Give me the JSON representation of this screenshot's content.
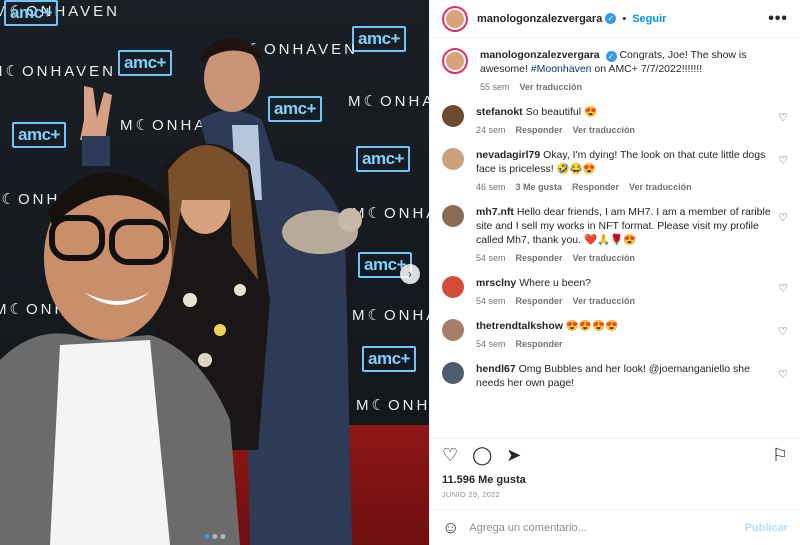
{
  "post": {
    "author": "manologonzalezvergara",
    "follow_label": "Seguir",
    "more_label": "•••",
    "caption": {
      "username": "manologonzalezvergara",
      "text_before": "Congrats, Joe! The show is awesome!",
      "hashtag": "#Moonhaven",
      "text_after": " on AMC+ 7/7/2022!!!!!!!",
      "time": "55 sem",
      "translate": "Ver traducción"
    },
    "likes": "11.596 Me gusta",
    "date": "JUNIO 29, 2022",
    "comment_placeholder": "Agrega un comentario...",
    "publish_label": "Publicar"
  },
  "photo": {
    "amc_logo": "amc+",
    "moonhaven_logo": "M☾ONHAVEN",
    "next_arrow": "›",
    "slide_count": 3,
    "active_slide": 1
  },
  "comments": [
    {
      "user": "stefanokt",
      "text": "So beautiful 😍",
      "time": "24 sem",
      "likes": "",
      "reply": "Responder",
      "translate": "Ver traducción"
    },
    {
      "user": "nevadagirl79",
      "text": "Okay, I'm dying! The look on that cute little dogs face is priceless! 🤣😂😍",
      "time": "46 sem",
      "likes": "3 Me gusta",
      "reply": "Responder",
      "translate": "Ver traducción"
    },
    {
      "user": "mh7.nft",
      "text": "Hello dear friends, I am MH7. I am a member of rarible site and I sell my works in NFT format. Please visit my profile called Mh7, thank you. ❤️🙏🌹😍",
      "time": "54 sem",
      "likes": "",
      "reply": "Responder",
      "translate": "Ver traducción"
    },
    {
      "user": "mrsclny",
      "text": "Where u been?",
      "time": "54 sem",
      "likes": "",
      "reply": "Responder",
      "translate": "Ver traducción"
    },
    {
      "user": "thetrendtalkshow",
      "text": "😍😍😍😍",
      "time": "54 sem",
      "likes": "",
      "reply": "Responder",
      "translate": ""
    },
    {
      "user": "hendl67",
      "text": "Omg Bubbles and her look! @joemanganiello she needs her own page!",
      "time": "",
      "likes": "",
      "reply": "",
      "translate": ""
    }
  ],
  "icons": {
    "like": "heart-outline-icon",
    "comment": "comment-bubble-icon",
    "share": "paper-plane-icon",
    "save": "bookmark-icon",
    "emoji": "smiley-icon"
  },
  "colors": {
    "accent": "#0095f6",
    "verified": "#3897f0",
    "carpet": "#8f1717",
    "amc": "#6ec6ff"
  }
}
